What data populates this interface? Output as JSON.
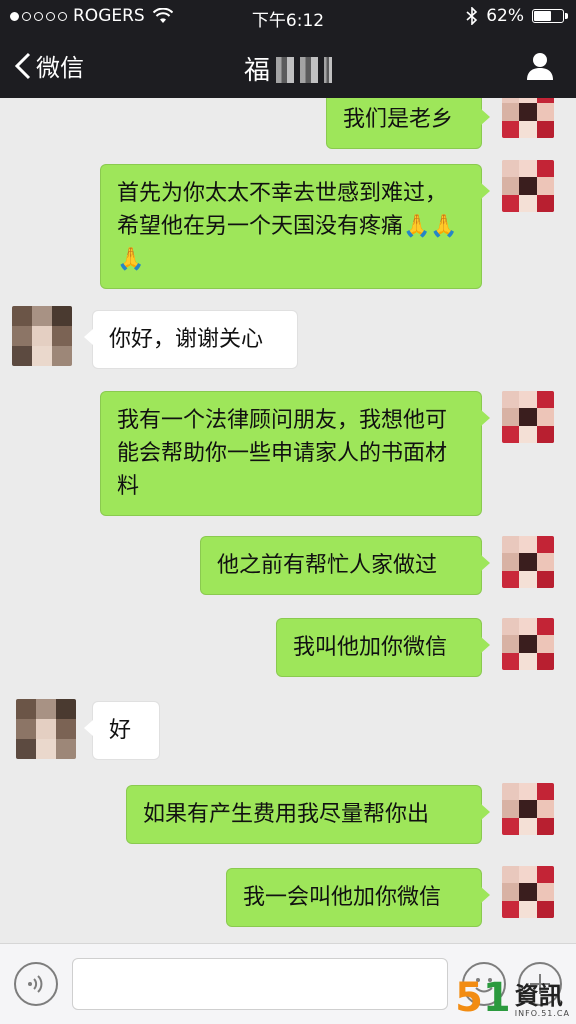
{
  "status_bar": {
    "carrier": "ROGERS",
    "time": "下午6:12",
    "battery": "62%",
    "battery_level": 0.62
  },
  "nav": {
    "back_label": "微信",
    "title": "福"
  },
  "messages": [
    {
      "side": "out",
      "text": "我们是老乡"
    },
    {
      "side": "out",
      "text": "首先为你太太不幸去世感到难过，希望他在另一个天国没有疼痛🙏🙏🙏"
    },
    {
      "side": "in",
      "text": "你好，谢谢关心"
    },
    {
      "side": "out",
      "text": "我有一个法律顾问朋友，我想他可能会帮助你一些申请家人的书面材料"
    },
    {
      "side": "out",
      "text": "他之前有帮忙人家做过"
    },
    {
      "side": "out",
      "text": "我叫他加你微信"
    },
    {
      "side": "in",
      "text": "好"
    },
    {
      "side": "out",
      "text": "如果有产生费用我尽量帮你出"
    },
    {
      "side": "out",
      "text": "我一会叫他加你微信"
    }
  ],
  "watermark": {
    "digits": "5",
    "digit_one": "1",
    "name": "資訊",
    "url": "INFO.51.CA"
  },
  "colors": {
    "header_bg": "#1d1d21",
    "chat_bg": "#ebebeb",
    "out_bubble": "#9ee65a",
    "in_bubble": "#ffffff"
  }
}
